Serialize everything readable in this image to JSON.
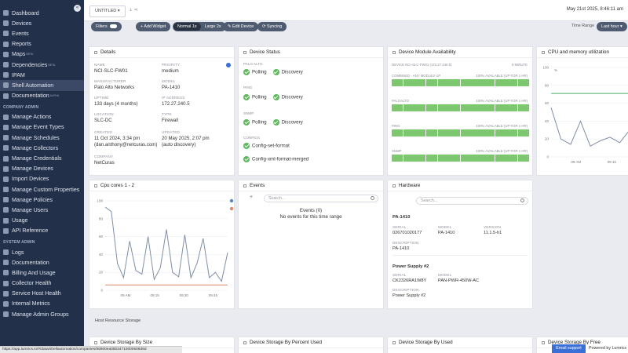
{
  "sidebar": {
    "collapse_label": "«",
    "items": [
      {
        "label": "Dashboard"
      },
      {
        "label": "Devices"
      },
      {
        "label": "Events"
      },
      {
        "label": "Reports"
      },
      {
        "label": "Maps",
        "badge": "BETA"
      },
      {
        "label": "Dependencies",
        "badge": "BETA"
      },
      {
        "label": "IPAM"
      },
      {
        "label": "Shell Automation",
        "active": true
      },
      {
        "label": "Documentation",
        "badge": "ALPHA"
      }
    ],
    "company_admin_header": "COMPANY ADMIN",
    "company_admin": [
      {
        "label": "Manage Actions"
      },
      {
        "label": "Manage Event Types"
      },
      {
        "label": "Manage Schedules"
      },
      {
        "label": "Manage Collectors"
      },
      {
        "label": "Manage Credentials"
      },
      {
        "label": "Manage Devices"
      },
      {
        "label": "Import Devices"
      },
      {
        "label": "Manage Custom Properties"
      },
      {
        "label": "Manage Policies"
      },
      {
        "label": "Manage Users"
      },
      {
        "label": "Usage"
      },
      {
        "label": "API Reference"
      }
    ],
    "system_admin_header": "SYSTEM ADMIN",
    "system_admin": [
      {
        "label": "Logs"
      },
      {
        "label": "Documentation"
      },
      {
        "label": "Billing And Usage"
      },
      {
        "label": "Collector Health"
      },
      {
        "label": "Service Host Health"
      },
      {
        "label": "Internal Metrics"
      },
      {
        "label": "Manage Admin Groups"
      }
    ]
  },
  "topbar": {
    "tab_label": "UNTITLED ▾",
    "tab_icons": "⇣ ⋖",
    "datetime": "May 21st 2025, 8:46:11 am"
  },
  "toolbar": {
    "filters": "Filters",
    "add_widget": "+ Add Widget",
    "normal": "Normal 1x",
    "large": "Large 2x",
    "edit_device": "✎ Edit Device",
    "syncing": "⟳ Syncing",
    "time_range_label": "Time Range",
    "time_range_value": "Last hour ▾"
  },
  "details": {
    "title": "Details",
    "fields": [
      {
        "label": "NAME",
        "value": "NCI-SLC-FW01"
      },
      {
        "label": "PRIORITY",
        "value": "medium"
      },
      {
        "label": "MANUFACTURER",
        "value": "Palo Alto Networks"
      },
      {
        "label": "MODEL",
        "value": "PA-1410"
      },
      {
        "label": "UPTIME",
        "value": "133 days (4 months)"
      },
      {
        "label": "IP ADDRESS",
        "value": "172.27.240.5"
      },
      {
        "label": "LOCATION",
        "value": "SLC-DC"
      },
      {
        "label": "TYPE",
        "value": "Firewall"
      },
      {
        "label": "CREATED",
        "value": "11 Oct 2024, 3:34 pm",
        "value2": "(dan.anthony@netcuras.com)"
      },
      {
        "label": "UPDATED",
        "value": "20 May 2025, 2:07 pm",
        "value2": "(auto discovery)"
      },
      {
        "label": "COMPANY",
        "value": "NetCuras"
      }
    ]
  },
  "device_status": {
    "title": "Device Status",
    "palo_alto_label": "PALO ALTO",
    "ping_label": "PING",
    "snmp_label": "SNMP",
    "configs_label": "CONFIGS",
    "polling": "Polling",
    "discovery": "Discovery",
    "config1": "Config-set-format",
    "config2": "Config-xml-format-merged"
  },
  "availability": {
    "title": "Device Module Availability",
    "device_label": "DEVICE NCI-SLC-FW01 (172.27.240.5)",
    "interval": "5 MINUTE",
    "rows": [
      {
        "label": "COMBINED - ANY MODULE UP",
        "pct": "100% AVAILABLE (UP FOR 1 HR)"
      },
      {
        "label": "PALOALTO",
        "pct": "100% AVAILABLE (UP FOR 1 HR)"
      },
      {
        "label": "PING",
        "pct": "100% AVAILABLE (UP FOR 1 HR)"
      },
      {
        "label": "SNMP",
        "pct": "100% AVAILABLE (UP FOR 1 HR)"
      }
    ]
  },
  "cpu_mem": {
    "title": "CPU and memory utilization",
    "ylabel": "%",
    "xticks": [
      "09 AM",
      "09:15"
    ]
  },
  "cpu_cores": {
    "title": "Cpu cores 1 - 2",
    "xticks": [
      "09 AM",
      "09:15",
      "09:30",
      "09:45"
    ]
  },
  "events": {
    "title": "Events",
    "plus": "+",
    "search_placeholder": "Search...",
    "count": "Events (0)",
    "empty": "No events for this time range"
  },
  "hardware": {
    "title": "Hardware",
    "search_placeholder": "Search...",
    "item1_name": "PA-1410",
    "serial_label": "SERIAL",
    "model_label": "MODEL",
    "version_label": "VERSION",
    "description_label": "DESCRIPTION",
    "item1_serial": "026701020177",
    "item1_model": "PA-1410",
    "item1_version": "11.1.5-h1",
    "item1_description": "PA-1410",
    "item2_name": "Power Supply #2",
    "item2_serial": "CK2326RA1W8Y",
    "item2_model": "PAN-PWR-450W-AC",
    "item2_description": "Power Supply #2"
  },
  "host_storage_title": "Host Resource Storage",
  "bottom_cards": [
    {
      "title": "Device Storage By Size"
    },
    {
      "title": "Device Storage By Percent Used"
    },
    {
      "title": "Device Storage By Used"
    },
    {
      "title": "Device Storage By Free"
    }
  ],
  "status_url": "https://app.lumrics.io/#/data/shellautomation/companies/56900ea05b34710000608d9d",
  "email_support": "Email support",
  "powered_by": "Powered by Lumrics",
  "chart_data": [
    {
      "type": "line",
      "title": "Cpu cores 1 - 2",
      "x": [
        "08:47",
        "08:50",
        "08:53",
        "08:56",
        "08:59",
        "09:02",
        "09:05",
        "09:08",
        "09:11",
        "09:14",
        "09:17",
        "09:20",
        "09:23",
        "09:26",
        "09:29",
        "09:32",
        "09:35",
        "09:38",
        "09:41",
        "09:44",
        "09:46"
      ],
      "ylim": [
        0,
        100
      ],
      "yticks": [
        0,
        20,
        40,
        60,
        80,
        100
      ],
      "series": [
        {
          "color": "#7f8fa6",
          "values": [
            93,
            88,
            30,
            14,
            55,
            22,
            18,
            60,
            12,
            25,
            68,
            20,
            15,
            62,
            14,
            30,
            58,
            14,
            20,
            10,
            42
          ]
        },
        {
          "color": "#d98c6b",
          "values": [
            6,
            6,
            6,
            6,
            6,
            6,
            6,
            6,
            6,
            6,
            6,
            6,
            6,
            6,
            6,
            6,
            6,
            6,
            6,
            6,
            6
          ]
        }
      ]
    },
    {
      "type": "line",
      "title": "CPU and memory utilization",
      "ylabel": "%",
      "ylim": [
        0,
        100
      ],
      "yticks": [
        0,
        20,
        40,
        60,
        80,
        100
      ],
      "x": [
        "08:47",
        "08:51",
        "08:55",
        "08:59",
        "09:03",
        "09:07",
        "09:11",
        "09:15",
        "09:19"
      ],
      "series": [
        {
          "color": "#4caf6a",
          "values": [
            71,
            71,
            71,
            71,
            71,
            71,
            71,
            71,
            71
          ]
        },
        {
          "color": "#7f8fa6",
          "values": [
            55,
            20,
            14,
            40,
            12,
            18,
            22,
            16,
            30
          ]
        }
      ]
    }
  ]
}
